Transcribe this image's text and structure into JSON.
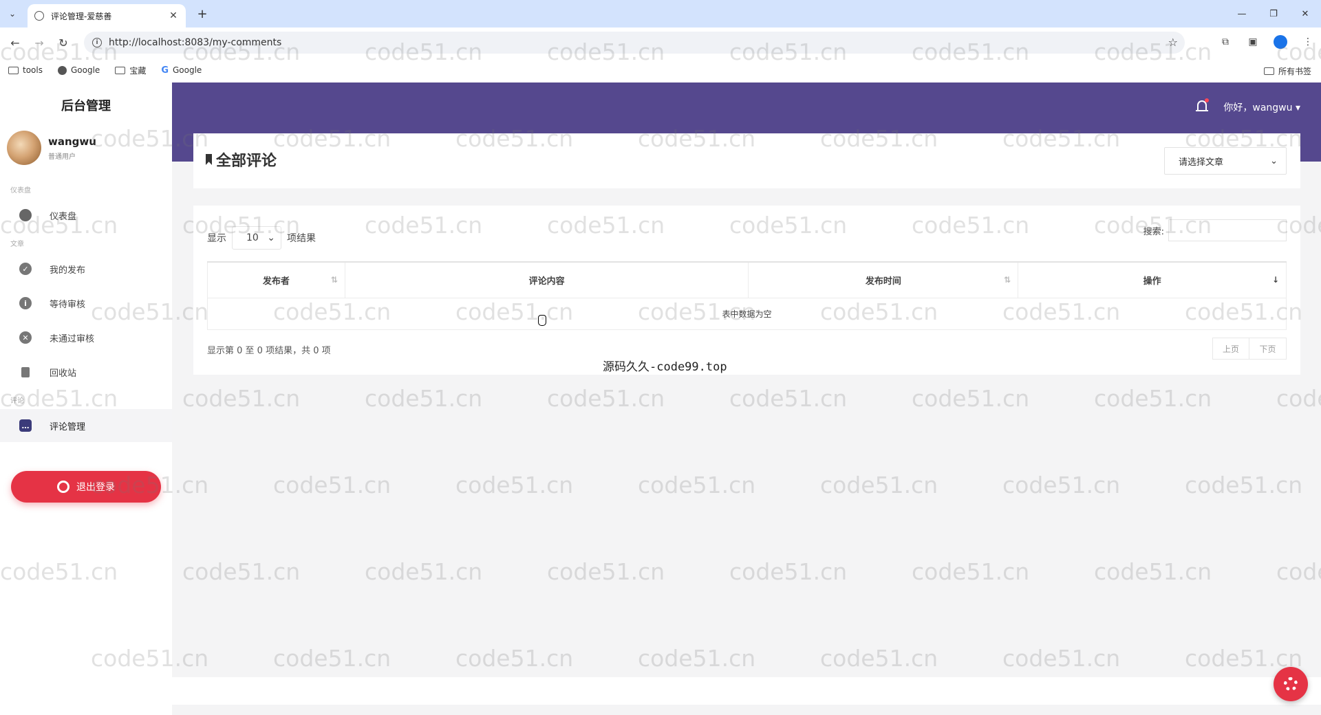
{
  "browser": {
    "tab_title": "评论管理-爱慈善",
    "url": "http://localhost:8083/my-comments",
    "bookmarks": [
      "tools",
      "Google",
      "宝藏",
      "Google"
    ],
    "all_bookmarks": "所有书签"
  },
  "app": {
    "brand": "后台管理",
    "user": {
      "name": "wangwu",
      "role": "普通用户"
    },
    "sections": {
      "dashboard": "仪表盘",
      "article": "文章",
      "comment": "评论"
    },
    "nav": {
      "dashboard": "仪表盘",
      "my_posts": "我的发布",
      "pending": "等待审核",
      "rejected": "未通过审核",
      "recycle": "回收站",
      "comments": "评论管理"
    },
    "logout": "退出登录",
    "greeting": "你好，wangwu"
  },
  "page": {
    "title": "全部评论",
    "article_select": "请选择文章",
    "show_prefix": "显示",
    "page_length": "10",
    "show_suffix": "项结果",
    "search_label": "搜索:",
    "columns": [
      "发布者",
      "评论内容",
      "发布时间",
      "操作"
    ],
    "empty_text": "表中数据为空",
    "info": "显示第 0 至 0 项结果，共 0 项",
    "prev": "上页",
    "next": "下页"
  },
  "overlay": {
    "credit": "源码久久-code99.top",
    "watermark": "code51.cn"
  }
}
